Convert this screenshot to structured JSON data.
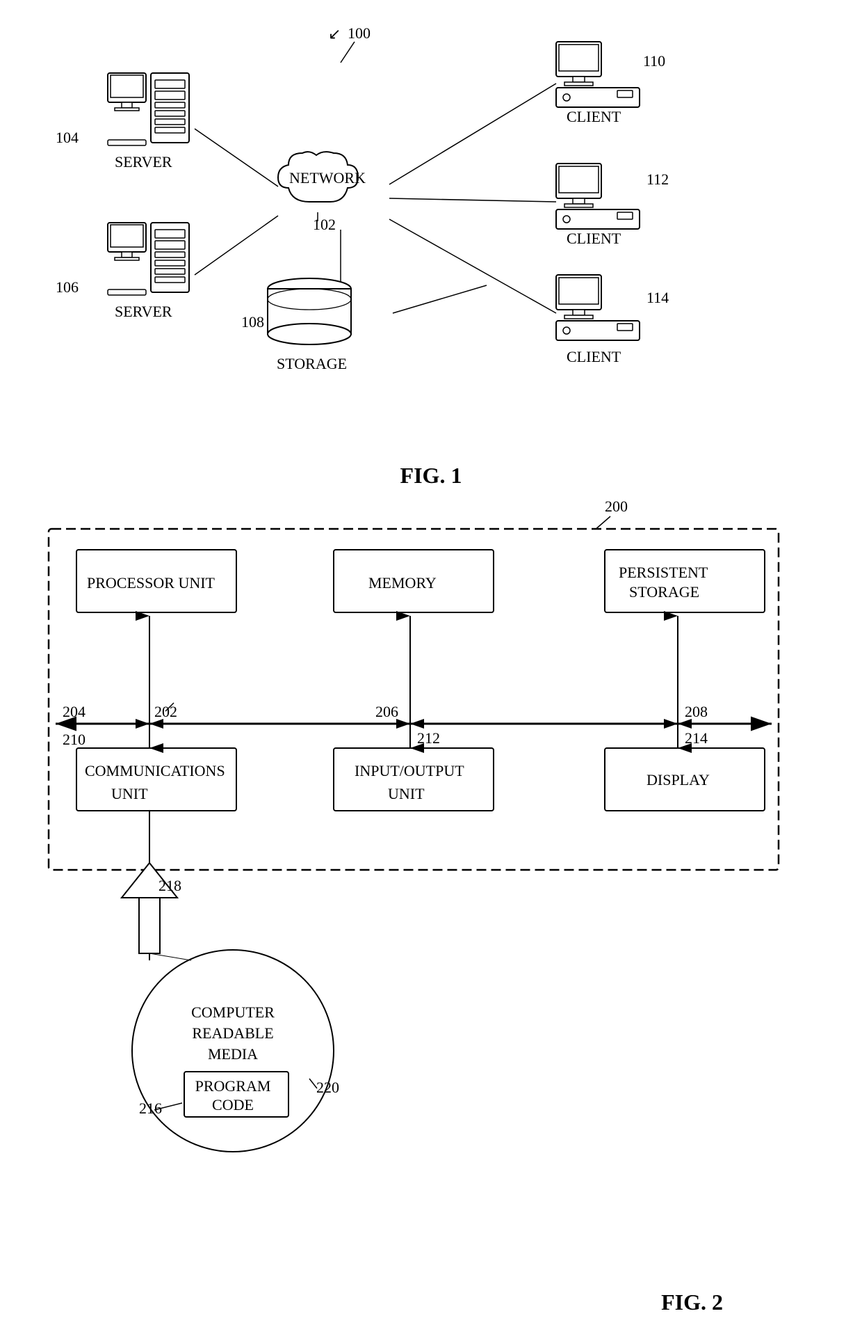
{
  "fig1": {
    "label": "FIG. 1",
    "ref_100": "100",
    "ref_102": "102",
    "ref_104": "104",
    "ref_106": "106",
    "ref_108": "108",
    "ref_110": "110",
    "ref_112": "112",
    "ref_114": "114",
    "network_label": "NETWORK",
    "storage_label": "STORAGE",
    "server1_label": "SERVER",
    "server2_label": "SERVER",
    "client1_label": "CLIENT",
    "client2_label": "CLIENT",
    "client3_label": "CLIENT"
  },
  "fig2": {
    "label": "FIG. 2",
    "ref_200": "200",
    "ref_202": "202",
    "ref_204": "204",
    "ref_206": "206",
    "ref_208": "208",
    "ref_210": "210",
    "ref_212": "212",
    "ref_214": "214",
    "ref_216": "216",
    "ref_218": "218",
    "ref_220": "220",
    "processor_label": "PROCESSOR UNIT",
    "memory_label": "MEMORY",
    "persistent_label1": "PERSISTENT",
    "persistent_label2": "STORAGE",
    "comms_label1": "COMMUNICATIONS UNIT",
    "io_label1": "INPUT/OUTPUT",
    "io_label2": "UNIT",
    "display_label": "DISPLAY",
    "media_label1": "COMPUTER",
    "media_label2": "READABLE",
    "media_label3": "MEDIA",
    "program_label1": "PROGRAM",
    "program_label2": "CODE"
  }
}
